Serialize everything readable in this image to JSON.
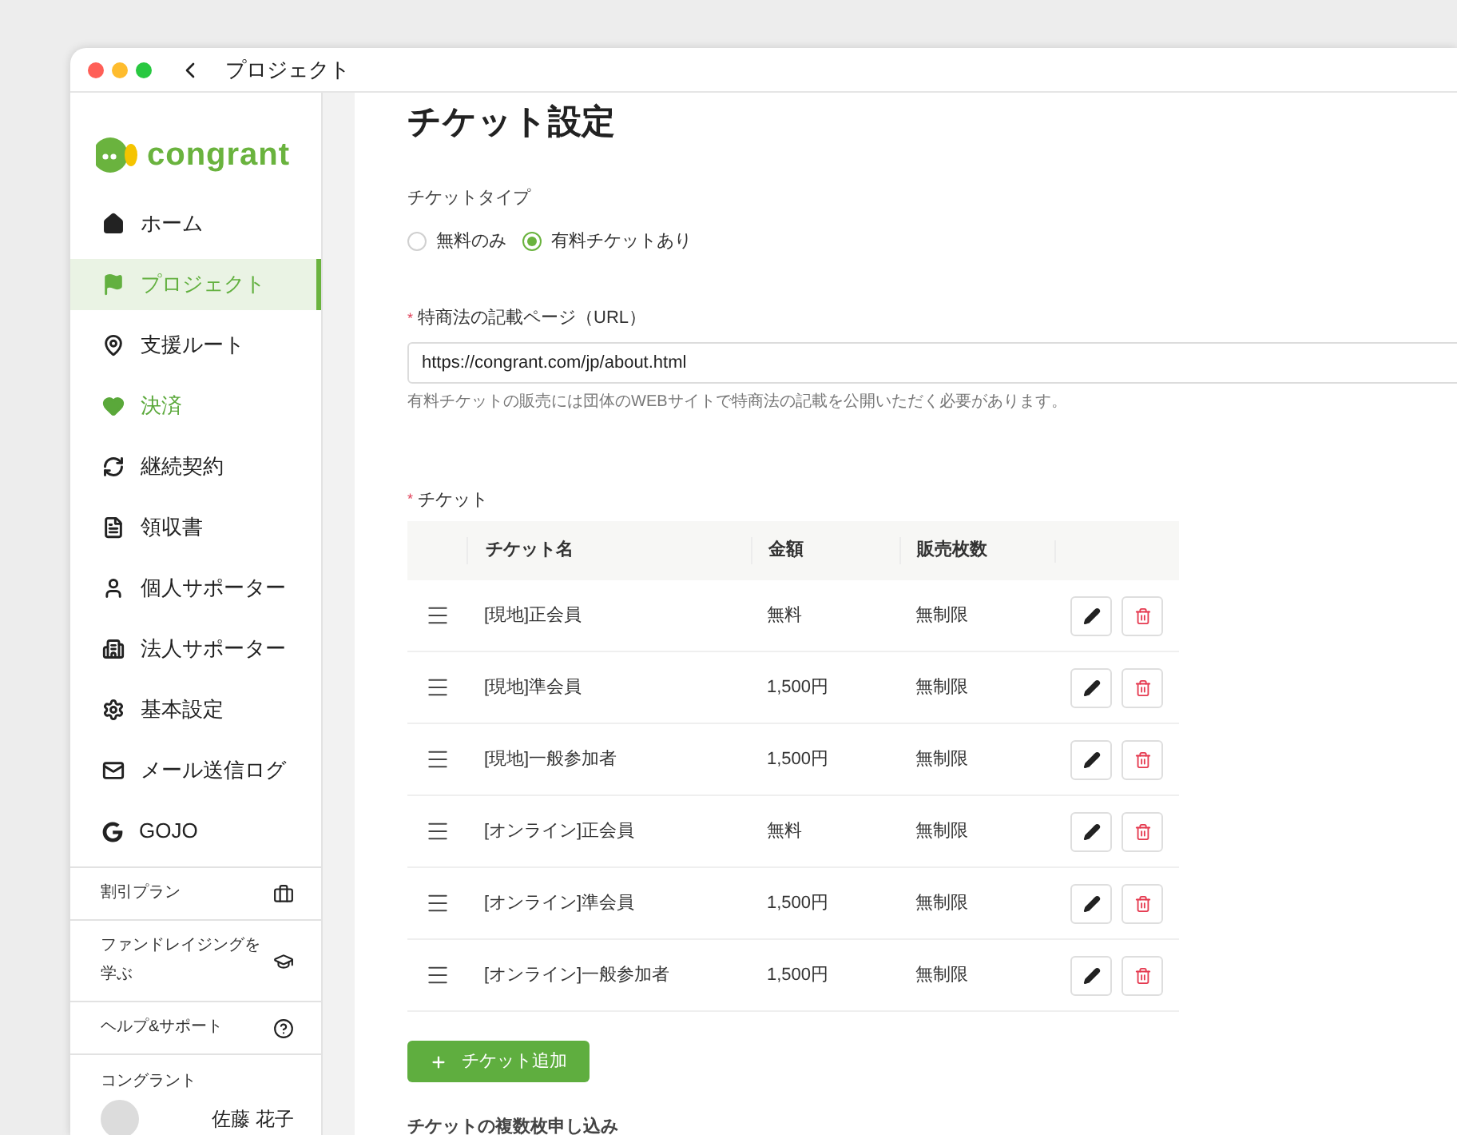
{
  "window": {
    "title": "プロジェクト"
  },
  "sidebar": {
    "logo_text": "congrant",
    "items": [
      {
        "kind": "home",
        "label": "ホーム",
        "selected": false,
        "highlighted": false
      },
      {
        "kind": "flag",
        "label": "プロジェクト",
        "selected": true,
        "highlighted": false
      },
      {
        "kind": "pin",
        "label": "支援ルート",
        "selected": false,
        "highlighted": false
      },
      {
        "kind": "heart",
        "label": "決済",
        "selected": false,
        "highlighted": true
      },
      {
        "kind": "refresh",
        "label": "継続契約",
        "selected": false,
        "highlighted": false
      },
      {
        "kind": "receipt",
        "label": "領収書",
        "selected": false,
        "highlighted": false
      },
      {
        "kind": "person",
        "label": "個人サポーター",
        "selected": false,
        "highlighted": false
      },
      {
        "kind": "building",
        "label": "法人サポーター",
        "selected": false,
        "highlighted": false
      },
      {
        "kind": "gear",
        "label": "基本設定",
        "selected": false,
        "highlighted": false
      },
      {
        "kind": "mail",
        "label": "メール送信ログ",
        "selected": false,
        "highlighted": false
      },
      {
        "kind": "g",
        "label": "GOJO",
        "selected": false,
        "highlighted": false
      }
    ],
    "links": [
      {
        "kind": "case",
        "label": "割引プラン"
      },
      {
        "kind": "cap",
        "label": "ファンドレイジングを学ぶ"
      },
      {
        "kind": "help",
        "label": "ヘルプ&サポート"
      }
    ],
    "account": {
      "org": "コングラント",
      "user": "佐藤 花子"
    }
  },
  "page": {
    "title": "チケット設定",
    "ticket_type": {
      "label": "チケットタイプ",
      "options": [
        {
          "label": "無料のみ",
          "selected": false
        },
        {
          "label": "有料チケットあり",
          "selected": true
        }
      ]
    },
    "url_field": {
      "label": "特商法の記載ページ（URL）",
      "required_mark": "*",
      "value": "https://congrant.com/jp/about.html",
      "help": "有料チケットの販売には団体のWEBサイトで特商法の記載を公開いただく必要があります。"
    },
    "tickets": {
      "label": "チケット",
      "required_mark": "*",
      "columns": [
        "チケット名",
        "金額",
        "販売枚数"
      ],
      "rows": [
        {
          "name": "[現地]正会員",
          "price": "無料",
          "count": "無制限"
        },
        {
          "name": "[現地]準会員",
          "price": "1,500円",
          "count": "無制限"
        },
        {
          "name": "[現地]一般参加者",
          "price": "1,500円",
          "count": "無制限"
        },
        {
          "name": "[オンライン]正会員",
          "price": "無料",
          "count": "無制限"
        },
        {
          "name": "[オンライン]準会員",
          "price": "1,500円",
          "count": "無制限"
        },
        {
          "name": "[オンライン]一般参加者",
          "price": "1,500円",
          "count": "無制限"
        }
      ],
      "add_button": "チケット追加"
    },
    "multi_label": "チケットの複数枚申し込み"
  }
}
